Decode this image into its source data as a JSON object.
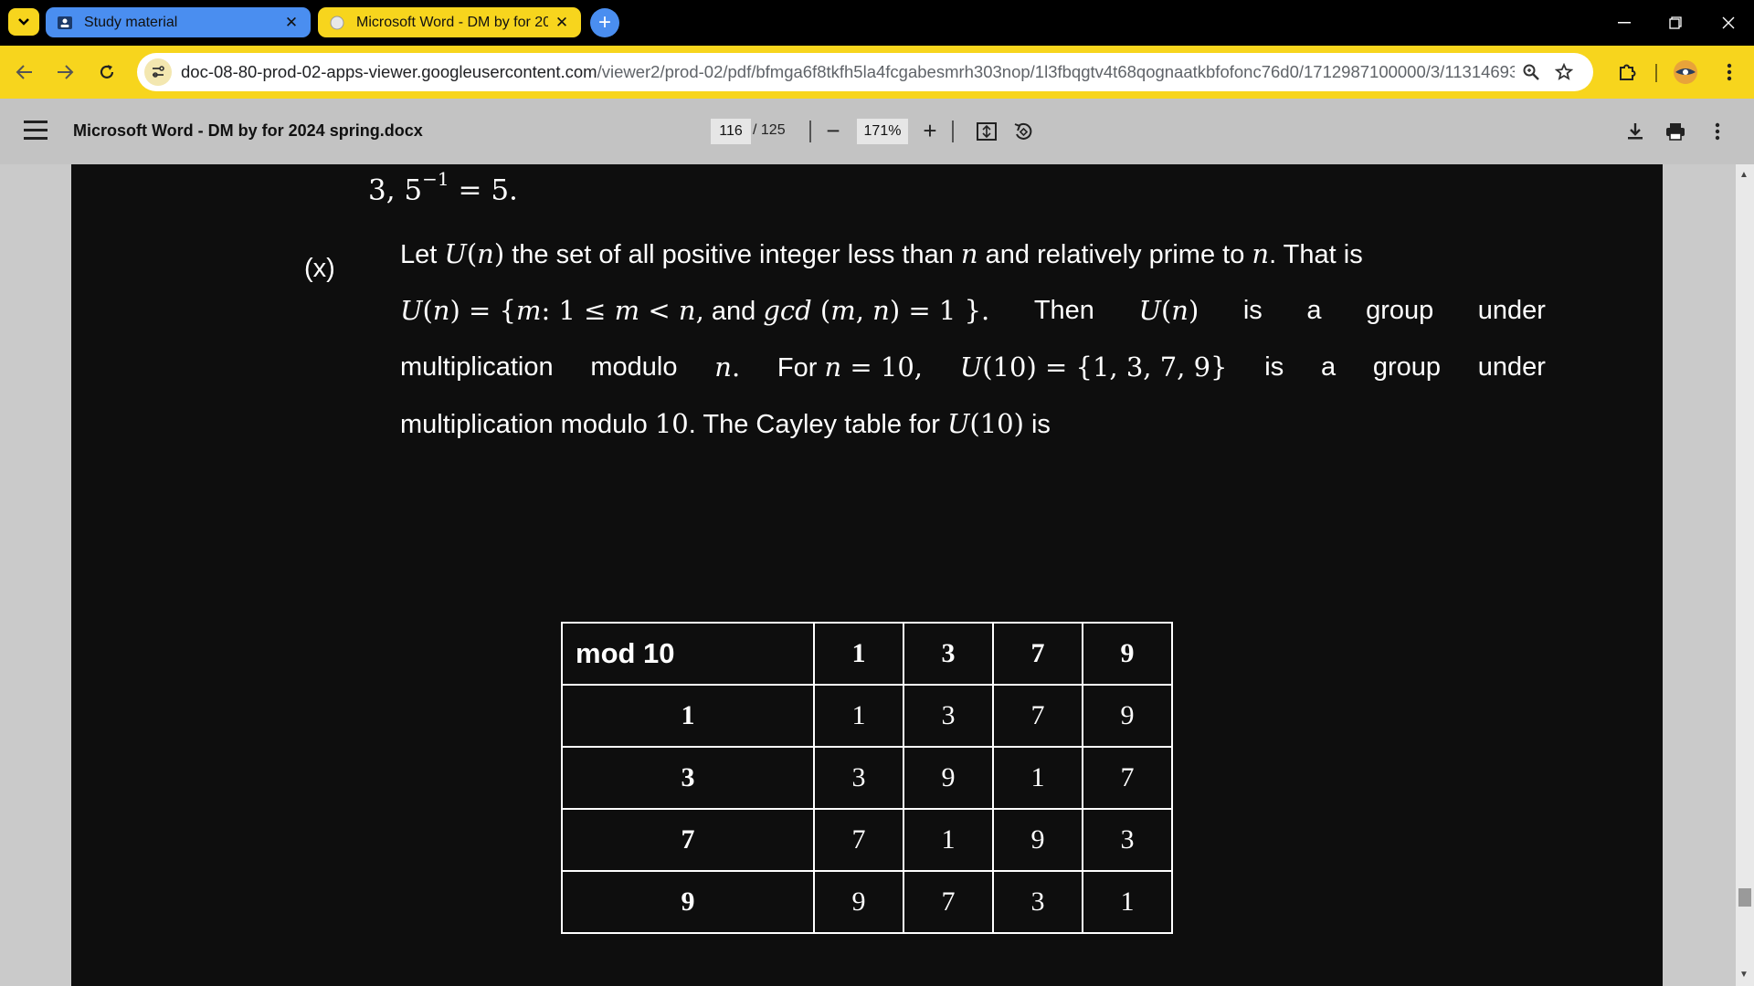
{
  "browser": {
    "tabs": [
      {
        "title": "Study material",
        "active": false
      },
      {
        "title": "Microsoft Word - DM by for 20",
        "active": true
      }
    ],
    "url_host": "doc-08-80-prod-02-apps-viewer.googleusercontent.com",
    "url_path": "/viewer2/prod-02/pdf/bfmga6f8tkfh5la4fcgabesmrh303nop/1l3fbqgtv4t68qognaatkbfofonc76d0/1712987100000/3/11314693006...",
    "icons": [
      "search-icon",
      "star-icon",
      "extensions-icon",
      "profile-avatar",
      "menu-icon"
    ]
  },
  "viewer": {
    "title": "Microsoft Word - DM by for 2024 spring.docx",
    "page_current": "116",
    "page_total": "/ 125",
    "zoom": "171%",
    "zoom_out": "−",
    "zoom_in": "+"
  },
  "document": {
    "prev_line": {
      "base": "3, 5",
      "sup": "−1",
      "rest": " = 5."
    },
    "item_label": "(x)",
    "cayley_table": {
      "corner": "mod 10",
      "columns": [
        "1",
        "3",
        "7",
        "9"
      ],
      "rows": [
        {
          "label": "1",
          "cells": [
            "1",
            "3",
            "7",
            "9"
          ]
        },
        {
          "label": "3",
          "cells": [
            "3",
            "9",
            "1",
            "7"
          ]
        },
        {
          "label": "7",
          "cells": [
            "7",
            "1",
            "9",
            "3"
          ]
        },
        {
          "label": "9",
          "cells": [
            "9",
            "7",
            "3",
            "1"
          ]
        }
      ]
    }
  },
  "colors": {
    "tab_active": "#f7d51d",
    "tab_inactive": "#4a8ef0",
    "toolbar": "#f7d51d",
    "pdf_toolbar": "#c3c3c3",
    "page_background": "#0e0e0e"
  }
}
